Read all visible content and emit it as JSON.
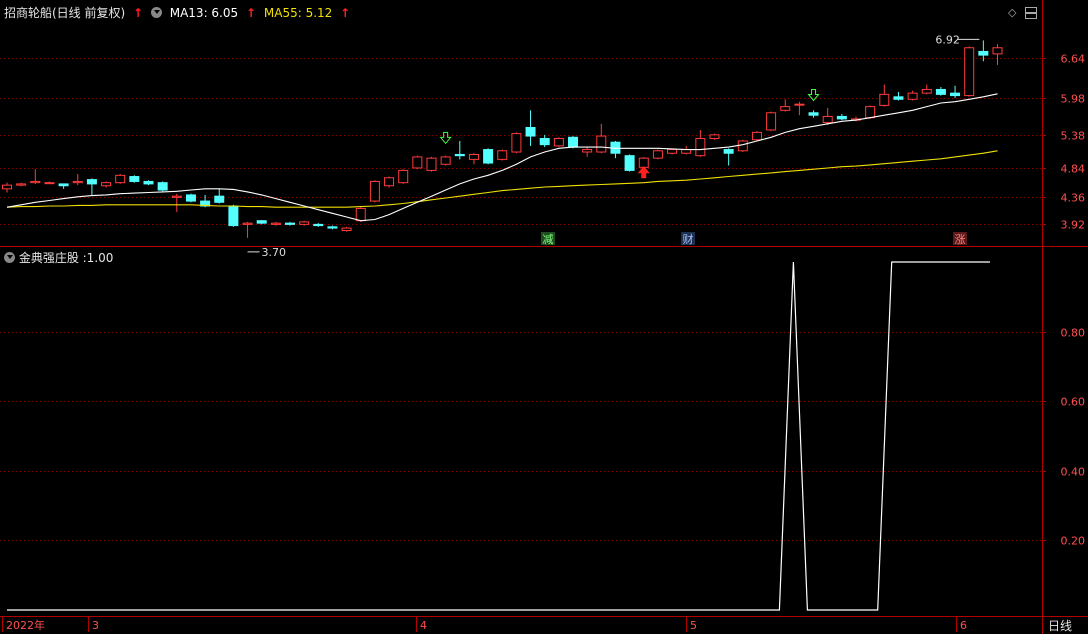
{
  "header": {
    "stock_title": "招商轮船(日线 前复权)",
    "ma13_label": "MA13: 6.05",
    "ma55_label": "MA55: 5.12",
    "up_arrow_glyph": "↑"
  },
  "indicator": {
    "title": "金典强庄股 :1.00"
  },
  "timeframe_button": "日线",
  "colors": {
    "up": "#ff3b3b",
    "down": "#54ffff",
    "ma13": "#ffffff",
    "ma55": "#f0e000",
    "grid": "#8a0000",
    "axis_border": "#b00000",
    "indicator_line": "#ffffff"
  },
  "chart_data": [
    {
      "type": "candlestick",
      "title": "招商轮船(日线 前复权)",
      "price_axis_ticks": [
        3.92,
        4.36,
        4.84,
        5.38,
        5.98,
        6.64
      ],
      "ylim": [
        3.6,
        7.22
      ],
      "annotations": [
        {
          "label": "6.92",
          "kind": "high"
        },
        {
          "label": "3.70",
          "kind": "low"
        }
      ],
      "event_markers": [
        "减",
        "财",
        "涨"
      ],
      "candles": [
        [
          4.5,
          4.56,
          4.44,
          4.6
        ],
        [
          4.56,
          4.58,
          4.54,
          4.6
        ],
        [
          4.6,
          4.62,
          4.58,
          4.82
        ],
        [
          4.6,
          4.6,
          4.58,
          4.62
        ],
        [
          4.58,
          4.55,
          4.5,
          4.58
        ],
        [
          4.6,
          4.62,
          4.56,
          4.74
        ],
        [
          4.65,
          4.58,
          4.4,
          4.67
        ],
        [
          4.55,
          4.6,
          4.52,
          4.62
        ],
        [
          4.6,
          4.72,
          4.58,
          4.74
        ],
        [
          4.7,
          4.62,
          4.6,
          4.72
        ],
        [
          4.62,
          4.58,
          4.56,
          4.64
        ],
        [
          4.6,
          4.48,
          4.46,
          4.62
        ],
        [
          4.36,
          4.38,
          4.12,
          4.42
        ],
        [
          4.4,
          4.3,
          4.28,
          4.42
        ],
        [
          4.3,
          4.22,
          4.2,
          4.4
        ],
        [
          4.38,
          4.28,
          4.26,
          4.5
        ],
        [
          4.22,
          3.9,
          3.88,
          4.24
        ],
        [
          3.92,
          3.94,
          3.7,
          3.96
        ],
        [
          3.98,
          3.94,
          3.92,
          3.99
        ],
        [
          3.92,
          3.94,
          3.9,
          3.96
        ],
        [
          3.94,
          3.92,
          3.9,
          3.96
        ],
        [
          3.92,
          3.96,
          3.9,
          3.98
        ],
        [
          3.92,
          3.9,
          3.88,
          3.94
        ],
        [
          3.88,
          3.86,
          3.84,
          3.9
        ],
        [
          3.82,
          3.86,
          3.8,
          3.88
        ],
        [
          3.98,
          4.18,
          3.96,
          4.2
        ],
        [
          4.3,
          4.62,
          4.28,
          4.64
        ],
        [
          4.55,
          4.68,
          4.52,
          4.7
        ],
        [
          4.6,
          4.8,
          4.58,
          4.82
        ],
        [
          4.84,
          5.02,
          4.82,
          5.04
        ],
        [
          4.8,
          5.0,
          4.78,
          5.02
        ],
        [
          4.9,
          5.02,
          4.88,
          5.04
        ],
        [
          5.06,
          5.04,
          4.98,
          5.28
        ],
        [
          4.98,
          5.06,
          4.9,
          5.08
        ],
        [
          5.14,
          4.92,
          4.9,
          5.16
        ],
        [
          4.98,
          5.12,
          4.96,
          5.14
        ],
        [
          5.1,
          5.4,
          5.08,
          5.42
        ],
        [
          5.5,
          5.36,
          5.2,
          5.78
        ],
        [
          5.32,
          5.22,
          5.18,
          5.38
        ],
        [
          5.2,
          5.32,
          5.18,
          5.34
        ],
        [
          5.34,
          5.18,
          5.16,
          5.36
        ],
        [
          5.1,
          5.14,
          5.02,
          5.18
        ],
        [
          5.1,
          5.36,
          5.08,
          5.56
        ],
        [
          5.26,
          5.08,
          5.0,
          5.28
        ],
        [
          5.04,
          4.8,
          4.78,
          5.06
        ],
        [
          4.85,
          5.0,
          4.82,
          5.02
        ],
        [
          5.0,
          5.12,
          4.98,
          5.14
        ],
        [
          5.08,
          5.14,
          5.06,
          5.16
        ],
        [
          5.08,
          5.14,
          5.06,
          5.2
        ],
        [
          5.04,
          5.32,
          5.02,
          5.46
        ],
        [
          5.32,
          5.38,
          5.3,
          5.4
        ],
        [
          5.14,
          5.08,
          4.88,
          5.16
        ],
        [
          5.12,
          5.28,
          5.1,
          5.3
        ],
        [
          5.3,
          5.42,
          5.28,
          5.44
        ],
        [
          5.46,
          5.74,
          5.44,
          5.76
        ],
        [
          5.78,
          5.84,
          5.76,
          5.96
        ],
        [
          5.88,
          5.88,
          5.7,
          5.92
        ],
        [
          5.74,
          5.7,
          5.66,
          5.78
        ],
        [
          5.58,
          5.68,
          5.54,
          5.82
        ],
        [
          5.68,
          5.64,
          5.62,
          5.72
        ],
        [
          5.62,
          5.64,
          5.6,
          5.68
        ],
        [
          5.66,
          5.84,
          5.64,
          5.86
        ],
        [
          5.86,
          6.04,
          5.84,
          6.2
        ],
        [
          6.0,
          5.96,
          5.94,
          6.08
        ],
        [
          5.96,
          6.06,
          5.94,
          6.1
        ],
        [
          6.06,
          6.12,
          6.04,
          6.2
        ],
        [
          6.12,
          6.04,
          6.02,
          6.16
        ],
        [
          6.06,
          6.02,
          5.98,
          6.18
        ],
        [
          6.02,
          6.8,
          6.0,
          6.82
        ],
        [
          6.74,
          6.68,
          6.58,
          6.92
        ],
        [
          6.7,
          6.8,
          6.52,
          6.86
        ]
      ],
      "ma13": [
        4.2,
        4.24,
        4.28,
        4.31,
        4.34,
        4.37,
        4.39,
        4.4,
        4.42,
        4.43,
        4.44,
        4.45,
        4.46,
        4.48,
        4.5,
        4.5,
        4.49,
        4.45,
        4.4,
        4.34,
        4.28,
        4.22,
        4.16,
        4.1,
        4.04,
        3.98,
        4.0,
        4.08,
        4.18,
        4.28,
        4.38,
        4.48,
        4.58,
        4.66,
        4.72,
        4.8,
        4.9,
        5.02,
        5.1,
        5.16,
        5.18,
        5.18,
        5.18,
        5.16,
        5.16,
        5.16,
        5.16,
        5.15,
        5.14,
        5.14,
        5.16,
        5.18,
        5.22,
        5.28,
        5.34,
        5.42,
        5.48,
        5.52,
        5.56,
        5.6,
        5.62,
        5.66,
        5.7,
        5.74,
        5.78,
        5.84,
        5.9,
        5.92,
        5.96,
        6.0,
        6.05
      ],
      "ma55": [
        4.2,
        4.21,
        4.21,
        4.22,
        4.22,
        4.23,
        4.23,
        4.24,
        4.24,
        4.24,
        4.24,
        4.24,
        4.24,
        4.24,
        4.23,
        4.22,
        4.22,
        4.21,
        4.21,
        4.2,
        4.2,
        4.2,
        4.2,
        4.2,
        4.2,
        4.21,
        4.22,
        4.24,
        4.26,
        4.29,
        4.32,
        4.35,
        4.38,
        4.41,
        4.44,
        4.47,
        4.49,
        4.51,
        4.53,
        4.54,
        4.55,
        4.56,
        4.57,
        4.58,
        4.59,
        4.6,
        4.62,
        4.63,
        4.64,
        4.66,
        4.68,
        4.7,
        4.72,
        4.74,
        4.76,
        4.78,
        4.8,
        4.82,
        4.84,
        4.86,
        4.87,
        4.89,
        4.91,
        4.93,
        4.95,
        4.97,
        4.99,
        5.02,
        5.05,
        5.08,
        5.12
      ]
    },
    {
      "type": "line",
      "title": "金典强庄股",
      "y_axis_ticks": [
        0.2,
        0.4,
        0.6,
        0.8
      ],
      "ylim": [
        0,
        1
      ],
      "x_axis_labels": [
        "2022年",
        "3",
        "4",
        "5",
        "6"
      ],
      "series": [
        {
          "values": [
            0,
            0,
            0,
            0,
            0,
            0,
            0,
            0,
            0,
            0,
            0,
            0,
            0,
            0,
            0,
            0,
            0,
            0,
            0,
            0,
            0,
            0,
            0,
            0,
            0,
            0,
            0,
            0,
            0,
            0,
            0,
            0,
            0,
            0,
            0,
            0,
            0,
            0,
            0,
            0,
            0,
            0,
            0,
            0,
            0,
            0,
            0,
            0,
            0,
            0,
            0,
            0,
            0,
            0,
            0,
            0,
            1,
            0,
            0,
            0,
            0,
            0,
            0,
            1,
            1,
            1,
            1,
            1,
            1,
            1,
            1
          ]
        }
      ]
    }
  ]
}
